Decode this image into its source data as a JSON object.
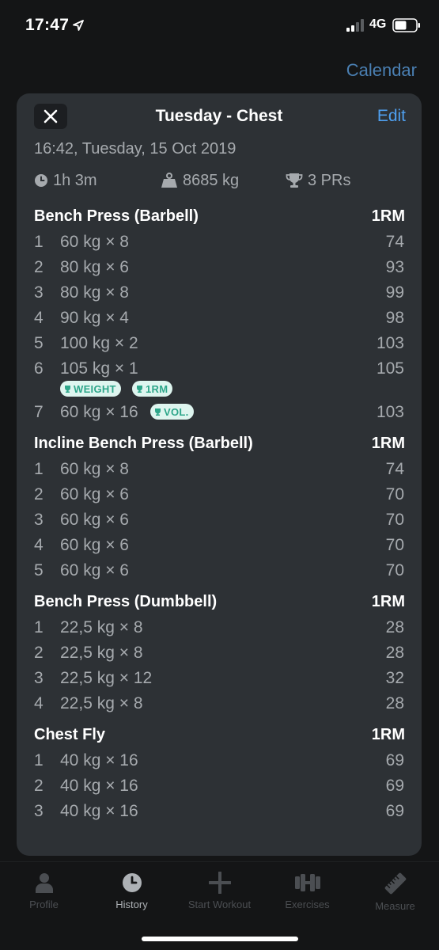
{
  "status_bar": {
    "time": "17:47",
    "network": "4G"
  },
  "background": {
    "calendar_label": "Calendar"
  },
  "sheet": {
    "title": "Tuesday - Chest",
    "edit_label": "Edit",
    "datetime": "16:42, Tuesday, 15 Oct 2019",
    "stats": {
      "duration": "1h 3m",
      "volume": "8685 kg",
      "prs": "3 PRs"
    }
  },
  "exercises": [
    {
      "name": "Bench Press (Barbell)",
      "metric": "1RM",
      "sets": [
        {
          "num": "1",
          "desc": "60 kg × 8",
          "value": "74"
        },
        {
          "num": "2",
          "desc": "80 kg × 6",
          "value": "93"
        },
        {
          "num": "3",
          "desc": "80 kg × 8",
          "value": "99"
        },
        {
          "num": "4",
          "desc": "90 kg × 4",
          "value": "98"
        },
        {
          "num": "5",
          "desc": "100 kg × 2",
          "value": "103"
        },
        {
          "num": "6",
          "desc": "105 kg × 1",
          "value": "105",
          "badges_below": [
            "WEIGHT",
            "1RM"
          ]
        },
        {
          "num": "7",
          "desc": "60 kg × 16",
          "value": "103",
          "badges_inline": [
            "VOL."
          ]
        }
      ]
    },
    {
      "name": "Incline Bench Press (Barbell)",
      "metric": "1RM",
      "sets": [
        {
          "num": "1",
          "desc": "60 kg × 8",
          "value": "74"
        },
        {
          "num": "2",
          "desc": "60 kg × 6",
          "value": "70"
        },
        {
          "num": "3",
          "desc": "60 kg × 6",
          "value": "70"
        },
        {
          "num": "4",
          "desc": "60 kg × 6",
          "value": "70"
        },
        {
          "num": "5",
          "desc": "60 kg × 6",
          "value": "70"
        }
      ]
    },
    {
      "name": "Bench Press (Dumbbell)",
      "metric": "1RM",
      "sets": [
        {
          "num": "1",
          "desc": "22,5 kg × 8",
          "value": "28"
        },
        {
          "num": "2",
          "desc": "22,5 kg × 8",
          "value": "28"
        },
        {
          "num": "3",
          "desc": "22,5 kg × 12",
          "value": "32"
        },
        {
          "num": "4",
          "desc": "22,5 kg × 8",
          "value": "28"
        }
      ]
    },
    {
      "name": "Chest Fly",
      "metric": "1RM",
      "sets": [
        {
          "num": "1",
          "desc": "40 kg × 16",
          "value": "69"
        },
        {
          "num": "2",
          "desc": "40 kg × 16",
          "value": "69"
        },
        {
          "num": "3",
          "desc": "40 kg × 16",
          "value": "69"
        }
      ]
    }
  ],
  "tabbar": {
    "items": [
      {
        "label": "Profile",
        "icon": "person-icon",
        "active": false
      },
      {
        "label": "History",
        "icon": "clock-icon",
        "active": true
      },
      {
        "label": "Start Workout",
        "icon": "plus-icon",
        "active": false
      },
      {
        "label": "Exercises",
        "icon": "dumbbell-icon",
        "active": false
      },
      {
        "label": "Measure",
        "icon": "ruler-icon",
        "active": false
      }
    ]
  },
  "colors": {
    "accent_blue": "#4fa0f0",
    "pr_badge_bg": "#def5ef",
    "pr_badge_text": "#2ea68a",
    "sheet_bg": "#2d3135"
  }
}
